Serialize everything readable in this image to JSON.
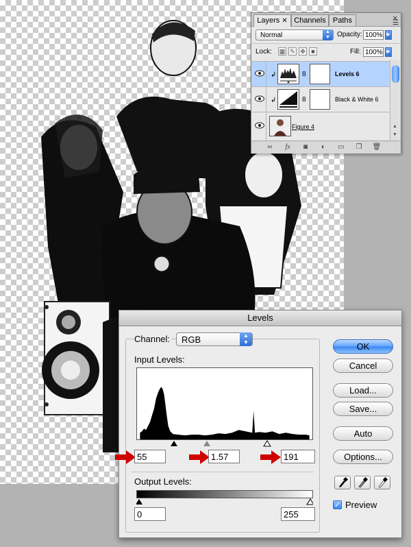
{
  "layers_panel": {
    "tabs": [
      {
        "label": "Layers",
        "active": true
      },
      {
        "label": "Channels",
        "active": false
      },
      {
        "label": "Paths",
        "active": false
      }
    ],
    "blend_mode": "Normal",
    "opacity_label": "Opacity:",
    "opacity_value": "100%",
    "lock_label": "Lock:",
    "fill_label": "Fill:",
    "fill_value": "100%",
    "layers": [
      {
        "name": "Levels 6",
        "selected": true,
        "type": "adjustment"
      },
      {
        "name": "Black & White 6",
        "selected": false,
        "type": "adjustment"
      },
      {
        "name": "Figure 4",
        "selected": false,
        "type": "image"
      }
    ]
  },
  "levels_dialog": {
    "title": "Levels",
    "channel_label": "Channel:",
    "channel_value": "RGB",
    "input_levels_label": "Input Levels:",
    "input_black": "55",
    "input_gamma": "1.57",
    "input_white": "191",
    "output_levels_label": "Output Levels:",
    "output_black": "0",
    "output_white": "255",
    "buttons": {
      "ok": "OK",
      "cancel": "Cancel",
      "load": "Load...",
      "save": "Save...",
      "auto": "Auto",
      "options": "Options..."
    },
    "preview_label": "Preview",
    "preview_checked": true
  },
  "colors": {
    "accent_blue": "#3a86f2",
    "selection_blue": "#b5d3ff",
    "annotation_red": "#d00000"
  }
}
